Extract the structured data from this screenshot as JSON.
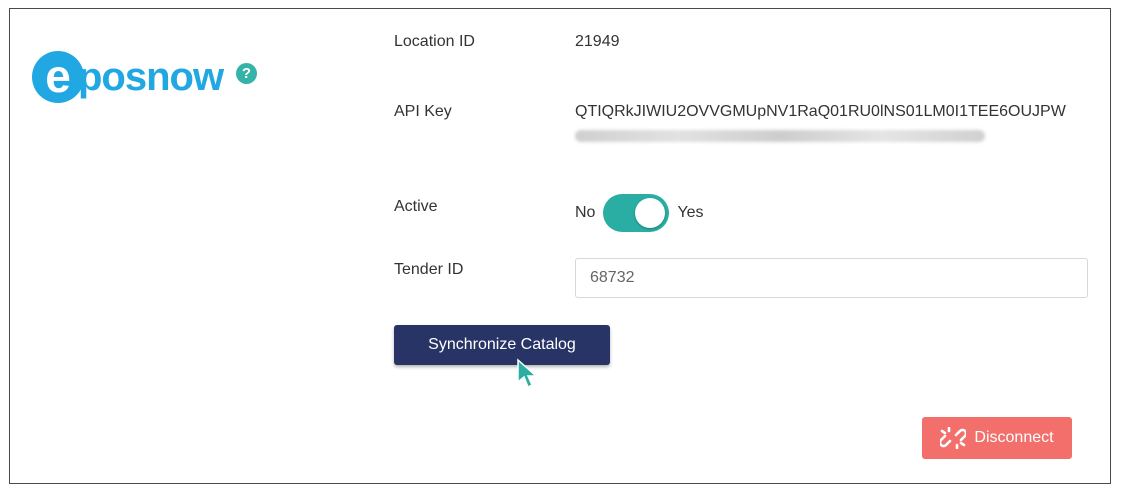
{
  "logo": {
    "initial": "e",
    "wordmark": "posnow",
    "help_glyph": "?"
  },
  "fields": {
    "location": {
      "label": "Location ID",
      "value": "21949"
    },
    "api_key": {
      "label": "API Key",
      "value": "QTIQRkJIWIU2OVVGMUpNV1RaQ01RU0lNS01LM0I1TEE6OUJPW"
    },
    "active": {
      "label": "Active",
      "no_label": "No",
      "yes_label": "Yes",
      "state": "Yes"
    },
    "tender": {
      "label": "Tender ID",
      "value": "68732"
    }
  },
  "actions": {
    "sync_label": "Synchronize Catalog",
    "disconnect_label": "Disconnect"
  },
  "colors": {
    "brand_blue": "#21a8e3",
    "toggle_teal": "#2aaea4",
    "sync_navy": "#283466",
    "disconnect_red": "#f26f6b"
  },
  "icons": [
    "help-icon",
    "broken-link-icon",
    "mouse-cursor-icon"
  ]
}
